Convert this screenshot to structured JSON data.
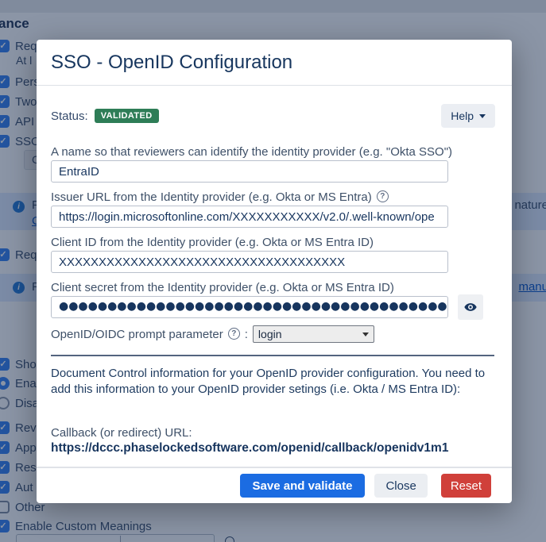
{
  "icons": {
    "check": "✓",
    "info": "i",
    "question": "?"
  },
  "colors": {
    "badge_green": "#2e7d57",
    "save_blue": "#1b6ce2",
    "reset_red": "#d0403a",
    "link_blue": "#0052cc",
    "checkbox_blue": "#2e7cf0",
    "overlay": "rgba(23,43,77,0.5)"
  },
  "background": {
    "heading": "ance",
    "rows": [
      {
        "type": "checkbox",
        "checked": true,
        "label": "Req",
        "sub": "At l"
      },
      {
        "type": "checkbox",
        "checked": true,
        "label": "Pers"
      },
      {
        "type": "checkbox",
        "checked": true,
        "label": "Two"
      },
      {
        "type": "checkbox",
        "checked": true,
        "label": "API"
      },
      {
        "type": "checkbox",
        "checked": true,
        "label": "SSO"
      },
      {
        "type": "checkbox",
        "checked": true,
        "label": "Req"
      },
      {
        "type": "checkbox",
        "checked": true,
        "label": "Sho"
      },
      {
        "type": "radio",
        "selected": true,
        "label": "Ena"
      },
      {
        "type": "radio",
        "selected": false,
        "label": "Disa"
      },
      {
        "type": "checkbox",
        "checked": true,
        "label": "Rev"
      },
      {
        "type": "checkbox",
        "checked": true,
        "label": "App"
      },
      {
        "type": "checkbox",
        "checked": true,
        "label": "Res"
      },
      {
        "type": "checkbox",
        "checked": true,
        "label": "Aut"
      },
      {
        "type": "checkbox",
        "checked": false,
        "label": "Other"
      },
      {
        "type": "checkbox",
        "checked": true,
        "label": "Enable Custom Meanings"
      }
    ],
    "configure_button": "Co",
    "banner1": {
      "left_fragment": "F",
      "link_fragment": "C",
      "right_fragment": "nature"
    },
    "banner2": {
      "left_fragment": "F",
      "right_link_fragment": "manu"
    }
  },
  "modal": {
    "title": "SSO - OpenID Configuration",
    "status_label": "Status:",
    "status_badge": "VALIDATED",
    "help_button": "Help",
    "fields": {
      "name": {
        "label": "A name so that reviewers can identify the identity provider (e.g. \"Okta SSO\")",
        "value": "EntraID"
      },
      "issuer": {
        "label": "Issuer URL from the Identity provider (e.g. Okta or MS Entra)",
        "value": "https://login.microsoftonline.com/XXXXXXXXXXX/v2.0/.well-known/ope"
      },
      "client_id": {
        "label": "Client ID from the Identity provider (e.g. Okta or MS Entra ID)",
        "value": "XXXXXXXXXXXXXXXXXXXXXXXXXXXXXXXXXXXX"
      },
      "client_secret": {
        "label": "Client secret from the Identity provider (e.g. Okta or MS Entra ID)",
        "value_masked": "●●●●●●●●●●●●●●●●●●●●●●●●●●●●●●●●●●●●●●●●"
      },
      "prompt": {
        "label": "OpenID/OIDC prompt parameter",
        "separator": ":",
        "value": "login"
      }
    },
    "info_text": "Document Control information for your OpenID provider configuration. You need to add this information to your OpenID provider setings (i.e. Okta / MS Entra ID):",
    "callback_label": "Callback (or redirect) URL:",
    "callback_url": "https://dccc.phaselockedsoftware.com/openid/callback/openidv1m1",
    "buttons": {
      "save": "Save and validate",
      "close": "Close",
      "reset": "Reset"
    }
  }
}
